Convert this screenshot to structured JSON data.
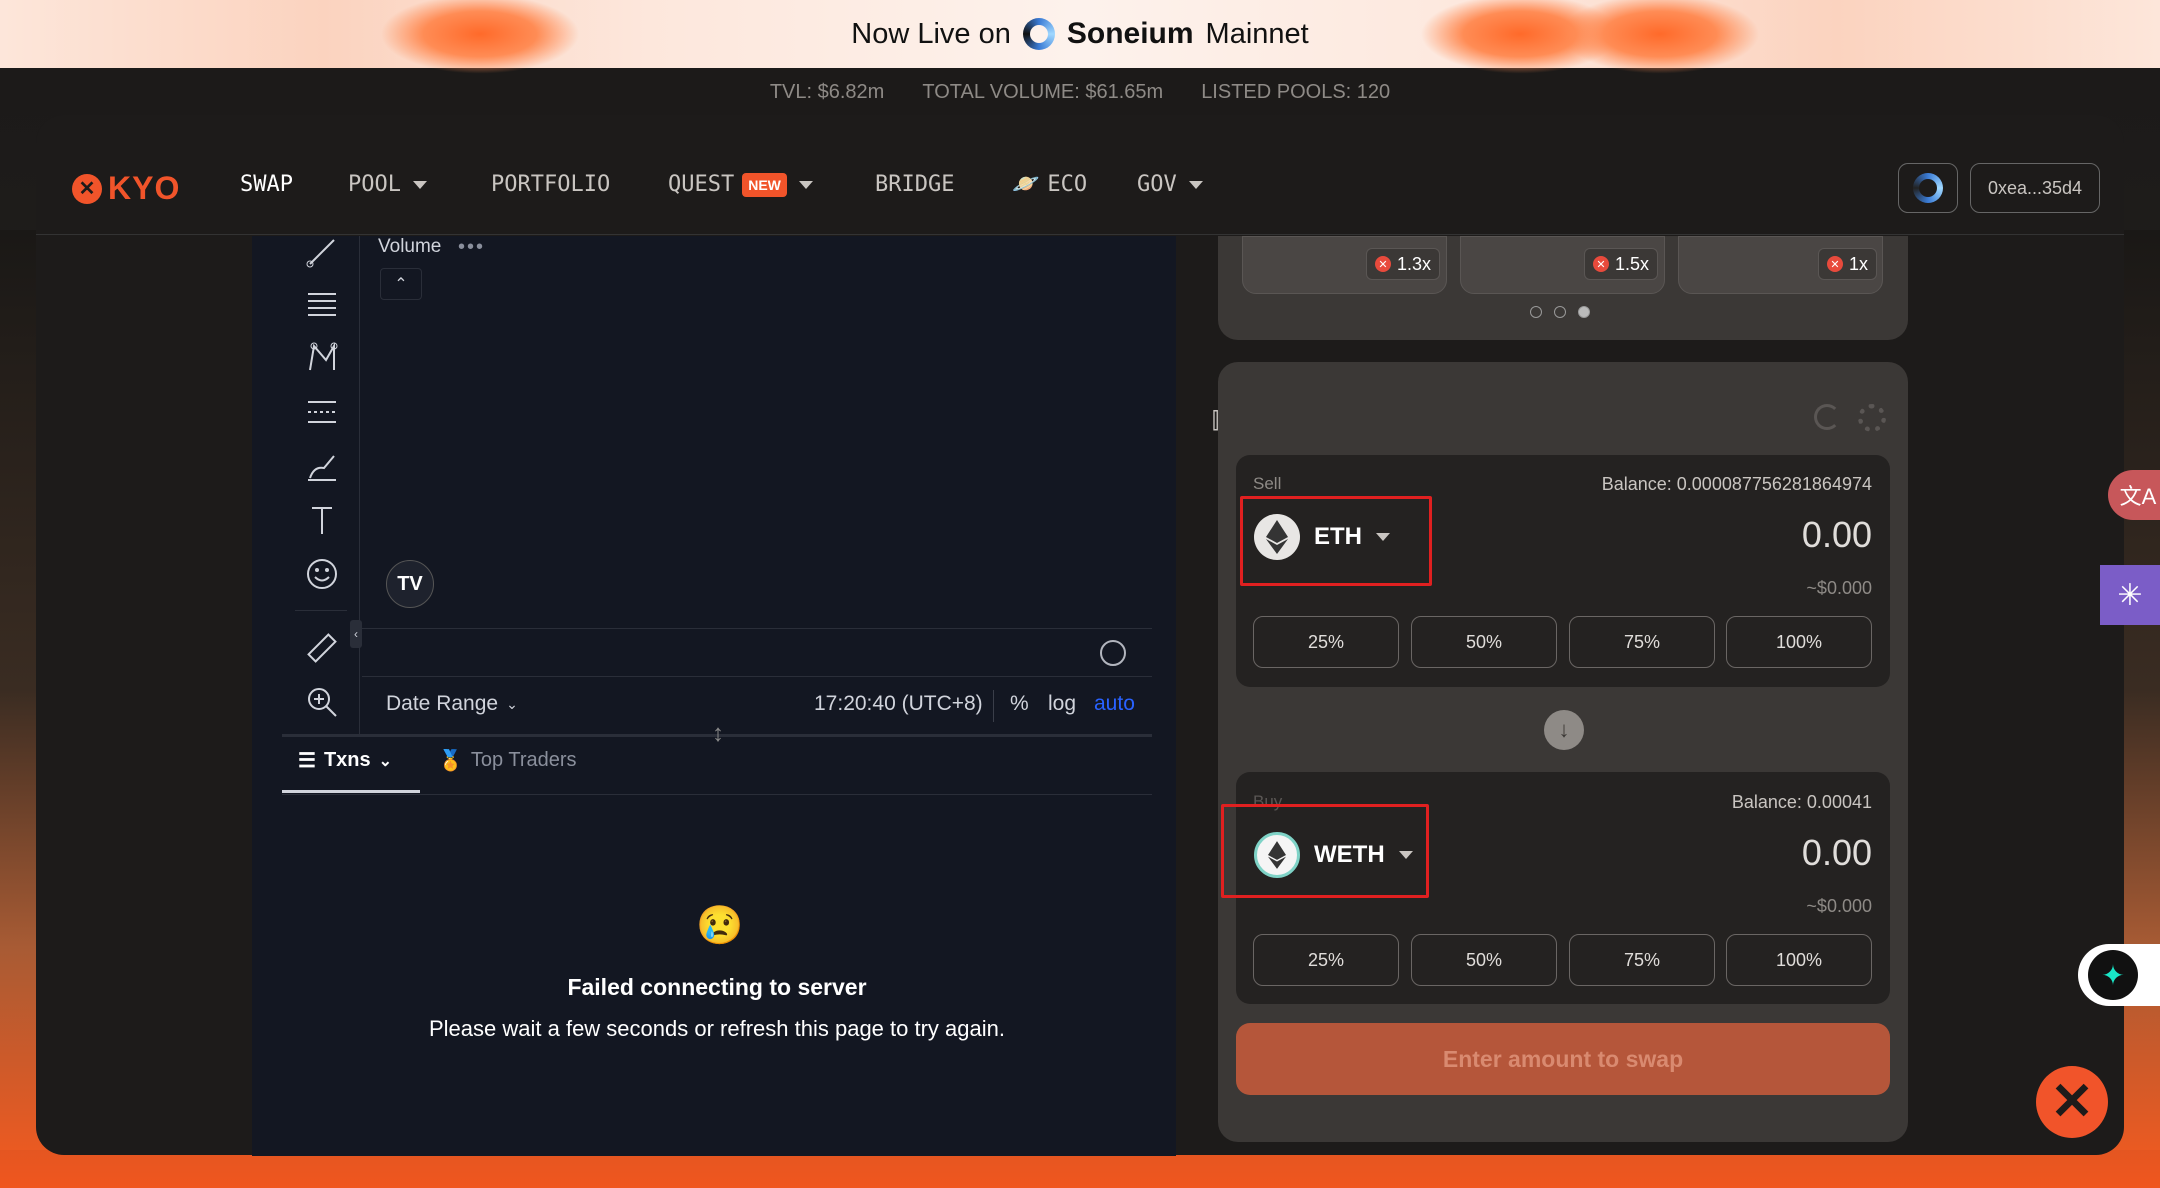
{
  "banner": {
    "prefix": "Now Live on",
    "brand": "Soneium",
    "suffix": "Mainnet"
  },
  "stats": {
    "tvl": "TVL: $6.82m",
    "volume": "TOTAL VOLUME: $61.65m",
    "pools": "LISTED POOLS: 120"
  },
  "nav": {
    "logo": "KYO",
    "items": [
      "SWAP",
      "POOL",
      "PORTFOLIO",
      "QUEST",
      "BRIDGE",
      "ECO",
      "GOV"
    ],
    "new_badge": "NEW",
    "wallet_address": "0xea...35d4"
  },
  "chart": {
    "volume_label": "Volume",
    "volume_dots": "•••",
    "date_range": "Date Range",
    "time": "17:20:40 (UTC+8)",
    "percent": "%",
    "log": "log",
    "auto": "auto"
  },
  "txns": {
    "tab_txns": "Txns",
    "tab_traders": "Top Traders",
    "fail_title": "Failed connecting to server",
    "fail_msg": "Please wait a few seconds or refresh this page to try again."
  },
  "multipliers": [
    "1.3x",
    "1.5x",
    "1x"
  ],
  "swap": {
    "sell": {
      "label": "Sell",
      "balance": "Balance: 0.000087756281864974",
      "token": "ETH",
      "amount": "0.00",
      "usd": "~$0.000"
    },
    "buy": {
      "label": "Buy",
      "balance": "Balance: 0.00041",
      "token": "WETH",
      "amount": "0.00",
      "usd": "~$0.000"
    },
    "pct_buttons": [
      "25%",
      "50%",
      "75%",
      "100%"
    ],
    "action": "Enter amount to swap"
  },
  "colors": {
    "accent": "#f1542a",
    "chart_bg": "#131722",
    "card_bg": "#3b3836"
  }
}
